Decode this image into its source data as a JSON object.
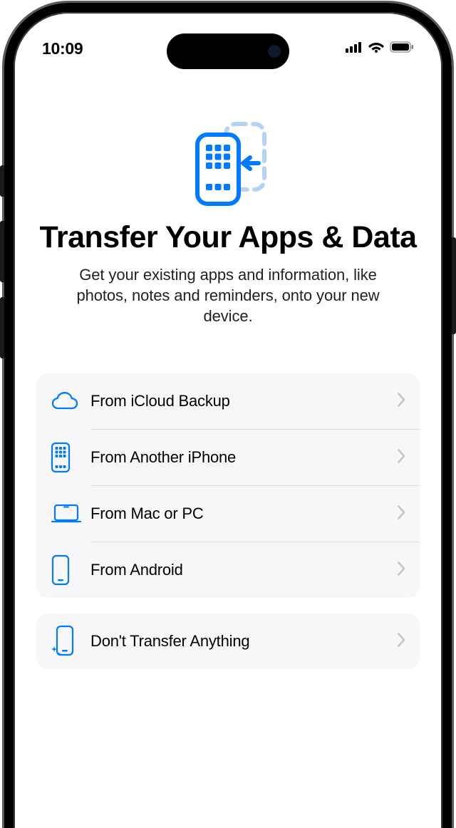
{
  "status": {
    "time": "10:09"
  },
  "hero": {
    "title": "Transfer Your Apps & Data",
    "subtitle": "Get your existing apps and information, like photos, notes and reminders, onto your new device."
  },
  "options": {
    "primary": [
      {
        "label": "From iCloud Backup",
        "icon": "cloud"
      },
      {
        "label": "From Another iPhone",
        "icon": "iphone-apps"
      },
      {
        "label": "From Mac or PC",
        "icon": "laptop"
      },
      {
        "label": "From Android",
        "icon": "phone-outline"
      }
    ],
    "secondary": [
      {
        "label": "Don't Transfer Anything",
        "icon": "phone-sparkle"
      }
    ]
  },
  "colors": {
    "accent": "#007aff",
    "accentLight": "#b6d4f2"
  }
}
